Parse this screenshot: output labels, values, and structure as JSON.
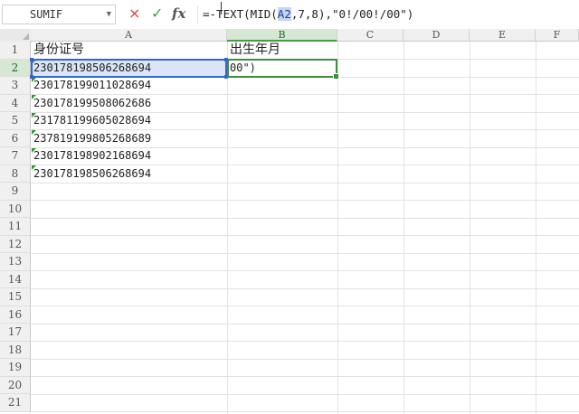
{
  "formula_bar": {
    "name_box": "SUMIF",
    "cancel_icon": "×",
    "enter_icon": "✓",
    "fx_label": "fx",
    "formula_before": "=",
    "formula_mid1": "-TEXT(MID(",
    "formula_ref": "A2",
    "formula_mid2": ",7,8),\"0!/00!/00\")"
  },
  "columns": [
    "A",
    "B",
    "C",
    "D",
    "E",
    "F"
  ],
  "rows": [
    "1",
    "2",
    "3",
    "4",
    "5",
    "6",
    "7",
    "8",
    "9",
    "10",
    "11",
    "12",
    "13",
    "14",
    "15",
    "16",
    "17",
    "18",
    "19",
    "20",
    "21"
  ],
  "cells": {
    "A1": "身份证号",
    "B1": "出生年月",
    "A2": "230178198506268694",
    "A3": "230178199011028694",
    "A4": "230178199508062686",
    "A5": "231781199605028694",
    "A6": "237819199805268689",
    "A7": "230178198902168694",
    "A8": "230178198506268694",
    "B2": "00\")"
  },
  "active_cell": "B2",
  "colors": {
    "accent_green": "#3e8e3e",
    "ref_blue": "#3366cc",
    "cancel_red": "#e04141"
  }
}
